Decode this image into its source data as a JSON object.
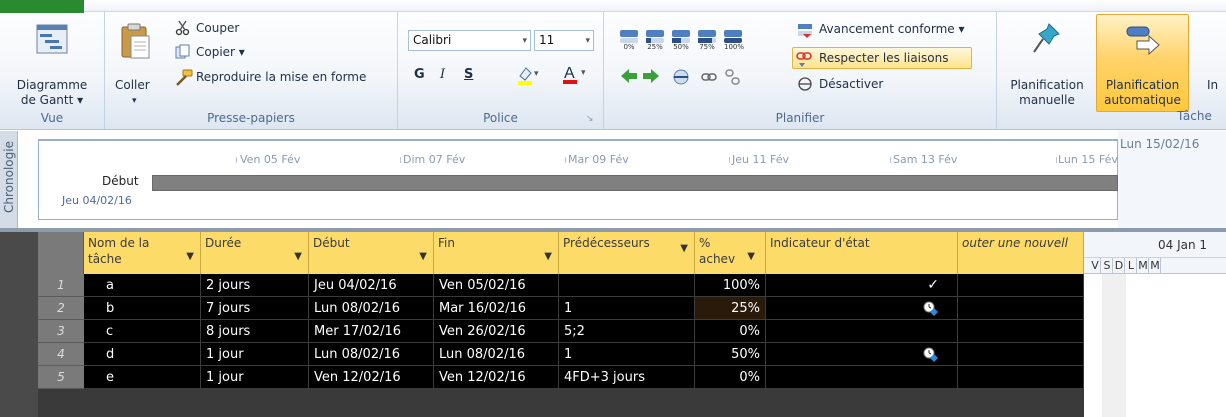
{
  "ribbon": {
    "vue": {
      "label": "Vue",
      "gantt_label_1": "Diagramme",
      "gantt_label_2": "de Gantt ▾"
    },
    "presse_papiers": {
      "label": "Presse-papiers",
      "coller": "Coller",
      "couper": "Couper",
      "copier": "Copier ▾",
      "reproduire": "Reproduire la mise en forme"
    },
    "police": {
      "label": "Police",
      "font": "Calibri",
      "size": "11",
      "bold": "G",
      "italic": "I",
      "underline": "S",
      "font_color_letter": "A"
    },
    "planifier": {
      "label": "Planifier",
      "pct_0": "0%",
      "pct_25": "25%",
      "pct_50": "50%",
      "pct_75": "75%",
      "pct_100": "100%",
      "avancement": "Avancement conforme ▾",
      "respecter": "Respecter les liaisons",
      "desactiver": "Désactiver"
    },
    "taches": {
      "label": "Tâche",
      "manuelle_1": "Planification",
      "manuelle_2": "manuelle",
      "auto_1": "Planification",
      "auto_2": "automatique",
      "partial": "In"
    }
  },
  "timeline": {
    "tab_label": "Chronologie",
    "start_label": "Début",
    "start_date": "Jeu 04/02/16",
    "end_date": "Lun 15/02/16",
    "dates": [
      "Ven 05 Fév",
      "Dim 07 Fév",
      "Mar 09 Fév",
      "Jeu 11 Fév",
      "Sam 13 Fév",
      "Lun 15 Fév"
    ]
  },
  "grid": {
    "columns": {
      "name_1": "Nom de la",
      "name_2": "tâche",
      "duree": "Durée",
      "debut": "Début",
      "fin": "Fin",
      "pred": "Prédécesseurs",
      "pct_1": "%",
      "pct_2": "achev",
      "indic": "Indicateur d'état",
      "add": "outer une nouvell"
    },
    "rows": [
      {
        "num": "1",
        "name": "a",
        "duree": "2 jours",
        "debut": "Jeu 04/02/16",
        "fin": "Ven 05/02/16",
        "pred": "",
        "pct": "100%"
      },
      {
        "num": "2",
        "name": "b",
        "duree": "7 jours",
        "debut": "Lun 08/02/16",
        "fin": "Mar 16/02/16",
        "pred": "1",
        "pct": "25%"
      },
      {
        "num": "3",
        "name": "c",
        "duree": "8 jours",
        "debut": "Mer 17/02/16",
        "fin": "Ven 26/02/16",
        "pred": "5;2",
        "pct": "0%"
      },
      {
        "num": "4",
        "name": "d",
        "duree": "1 jour",
        "debut": "Lun 08/02/16",
        "fin": "Lun 08/02/16",
        "pred": "1",
        "pct": "50%"
      },
      {
        "num": "5",
        "name": "e",
        "duree": "1 jour",
        "debut": "Ven 12/02/16",
        "fin": "Ven 12/02/16",
        "pred": "4FD+3 jours",
        "pct": "0%"
      }
    ]
  },
  "gantt": {
    "week_label": "04 Jan 1",
    "days": [
      "V",
      "S",
      "D",
      "L",
      "M",
      "M"
    ]
  }
}
